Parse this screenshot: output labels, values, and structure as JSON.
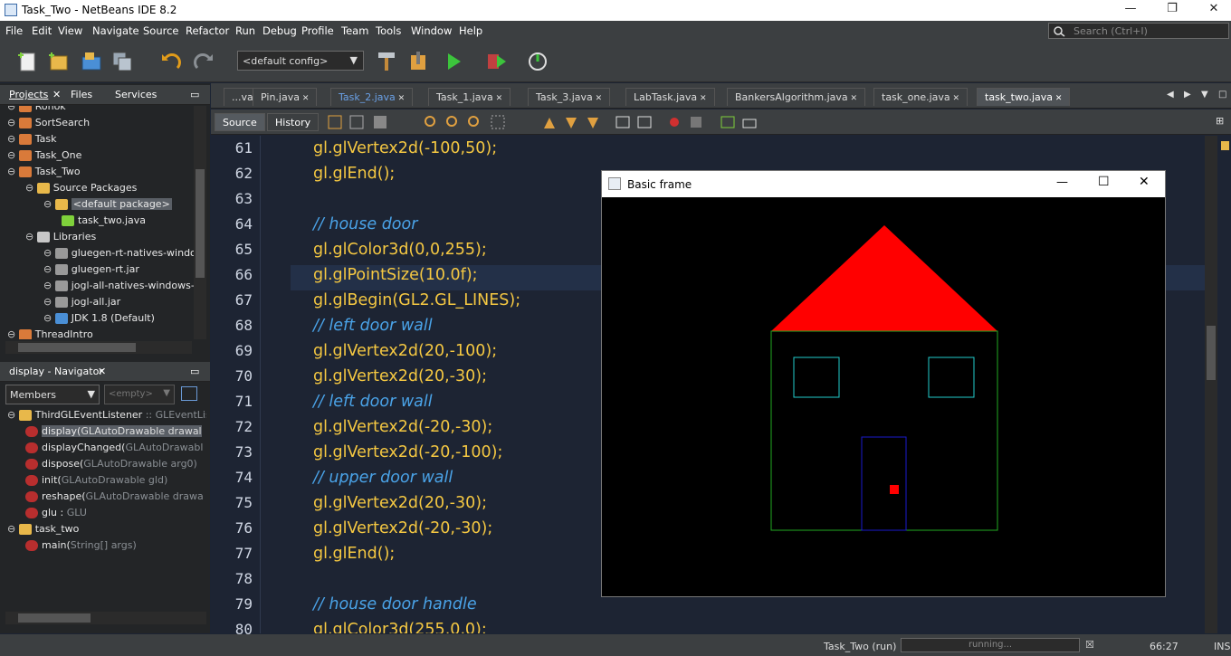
{
  "window": {
    "title": "Task_Two - NetBeans IDE 8.2",
    "minimize": "—",
    "maximize": "❐",
    "close": "✕"
  },
  "menu": [
    "File",
    "Edit",
    "View",
    "Navigate",
    "Source",
    "Refactor",
    "Run",
    "Debug",
    "Profile",
    "Team",
    "Tools",
    "Window",
    "Help"
  ],
  "search": {
    "placeholder": "Search (Ctrl+I)"
  },
  "toolbar": {
    "config": "<default config>"
  },
  "projects_panel": {
    "tabs": [
      "Projects",
      "Files",
      "Services"
    ],
    "nodes": [
      {
        "label": "Rohok",
        "level": 0
      },
      {
        "label": "SortSearch",
        "level": 0
      },
      {
        "label": "Task",
        "level": 0
      },
      {
        "label": "Task_One",
        "level": 0
      },
      {
        "label": "Task_Two",
        "level": 0
      },
      {
        "label": "Source Packages",
        "level": 1
      },
      {
        "label": "<default package>",
        "level": 2
      },
      {
        "label": "task_two.java",
        "level": 3
      },
      {
        "label": "Libraries",
        "level": 1
      },
      {
        "label": "gluegen-rt-natives-windo",
        "level": 2
      },
      {
        "label": "gluegen-rt.jar",
        "level": 2
      },
      {
        "label": "jogl-all-natives-windows-",
        "level": 2
      },
      {
        "label": "jogl-all.jar",
        "level": 2
      },
      {
        "label": "JDK 1.8 (Default)",
        "level": 2
      },
      {
        "label": "ThreadIntro",
        "level": 0
      }
    ]
  },
  "navigator": {
    "title": "display - Navigator",
    "filter": "Members",
    "empty": "<empty>",
    "items": [
      {
        "label": "ThirdGLEventListener",
        "suffix": " :: GLEventListe",
        "level": 0
      },
      {
        "label": "display(",
        "suffix": "GLAutoDrawable drawal",
        "level": 1
      },
      {
        "label": "displayChanged(",
        "suffix": "GLAutoDrawabl",
        "level": 1
      },
      {
        "label": "dispose(",
        "suffix": "GLAutoDrawable arg0)",
        "level": 1
      },
      {
        "label": "init(",
        "suffix": "GLAutoDrawable gld)",
        "level": 1
      },
      {
        "label": "reshape(",
        "suffix": "GLAutoDrawable drawa",
        "level": 1
      },
      {
        "label": "glu : ",
        "suffix": "GLU",
        "level": 1
      },
      {
        "label": "task_two",
        "suffix": "",
        "level": 0
      },
      {
        "label": "main(",
        "suffix": "String[] args)",
        "level": 1
      }
    ]
  },
  "editor": {
    "tabs": [
      "...va",
      "Pin.java",
      "Task_2.java",
      "Task_1.java",
      "Task_3.java",
      "LabTask.java",
      "BankersAlgorithm.java",
      "task_one.java",
      "task_two.java"
    ],
    "source_btn": "Source",
    "history_btn": "History",
    "lines": [
      {
        "n": "61",
        "t": "gl.glVertex2d(-100,50);"
      },
      {
        "n": "62",
        "t": "gl.glEnd();"
      },
      {
        "n": "63",
        "t": ""
      },
      {
        "n": "64",
        "t": "// house door"
      },
      {
        "n": "65",
        "t": "gl.glColor3d(0,0,255);"
      },
      {
        "n": "66",
        "t": "gl.glPointSize(10.0f);"
      },
      {
        "n": "67",
        "t": "gl.glBegin(GL2.GL_LINES);"
      },
      {
        "n": "68",
        "t": "// left door wall"
      },
      {
        "n": "69",
        "t": "gl.glVertex2d(20,-100);"
      },
      {
        "n": "70",
        "t": "gl.glVertex2d(20,-30);"
      },
      {
        "n": "71",
        "t": "// left door wall"
      },
      {
        "n": "72",
        "t": "gl.glVertex2d(-20,-30);"
      },
      {
        "n": "73",
        "t": "gl.glVertex2d(-20,-100);"
      },
      {
        "n": "74",
        "t": "// upper door wall"
      },
      {
        "n": "75",
        "t": "gl.glVertex2d(20,-30);"
      },
      {
        "n": "76",
        "t": "gl.glVertex2d(-20,-30);"
      },
      {
        "n": "77",
        "t": "gl.glEnd();"
      },
      {
        "n": "78",
        "t": ""
      },
      {
        "n": "79",
        "t": "// house door handle"
      },
      {
        "n": "80",
        "t": "gl.glColor3d(255,0,0);"
      }
    ]
  },
  "frame": {
    "title": "Basic frame"
  },
  "status": {
    "task": "Task_Two (run)",
    "progress": "running...",
    "position": "66:27",
    "mode": "INS"
  },
  "colors": {
    "roof": "#ff0000",
    "walls": "#22aa22",
    "windows": "#22cccc",
    "door": "#1a1acc",
    "handle": "#ff0000"
  }
}
